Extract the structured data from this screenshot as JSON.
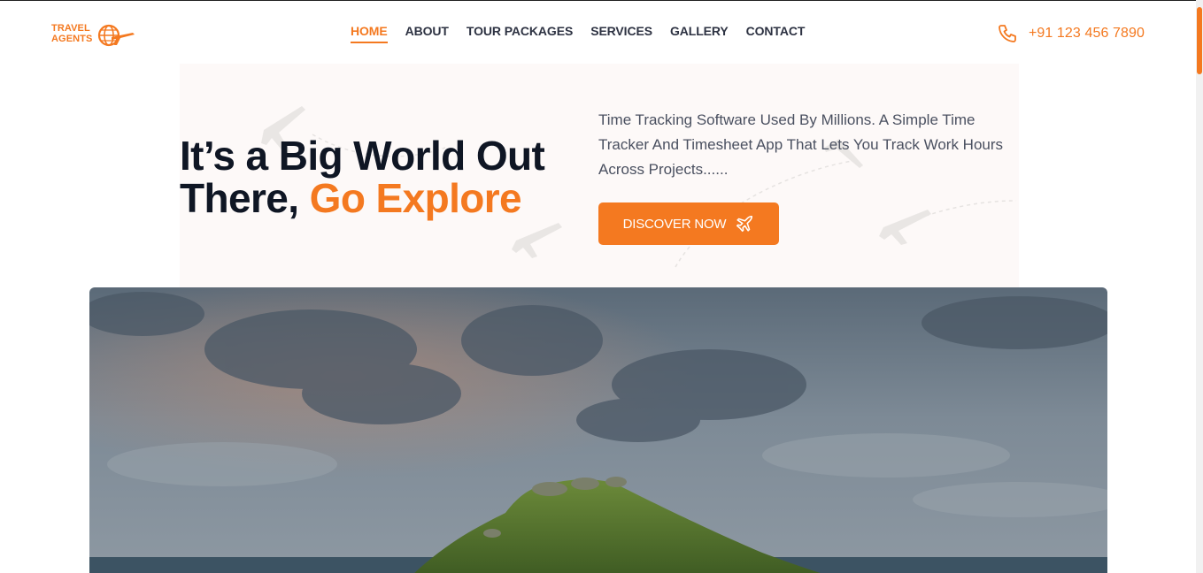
{
  "brand": {
    "line1": "TRAVEL",
    "line2": "AGENTS",
    "icon": "globe-plane-icon",
    "accent_color": "#f47920"
  },
  "nav": {
    "items": [
      {
        "label": "HOME",
        "active": true
      },
      {
        "label": "ABOUT",
        "active": false
      },
      {
        "label": "TOUR PACKAGES",
        "active": false
      },
      {
        "label": "SERVICES",
        "active": false
      },
      {
        "label": "GALLERY",
        "active": false
      },
      {
        "label": "CONTACT",
        "active": false
      }
    ]
  },
  "contact": {
    "icon": "phone-icon",
    "phone": "+91 123 456 7890"
  },
  "hero": {
    "title_line1": "It’s a Big World Out",
    "title_line2_prefix": "There,",
    "title_line2_accent": "Go Explore",
    "description": "Time Tracking Software Used By Millions. A Simple Time Tracker And Timesheet App That Lets You Track Work Hours Across Projects......",
    "cta_label": "DISCOVER NOW",
    "cta_icon": "airplane-icon",
    "decoration_icon": "airplane-icon"
  },
  "banner_image": {
    "subject": "island-landscape-photo"
  },
  "colors": {
    "accent": "#f47920",
    "heading": "#0f1624",
    "nav_text": "#2d3242",
    "hero_bg": "#fdf9f8"
  }
}
